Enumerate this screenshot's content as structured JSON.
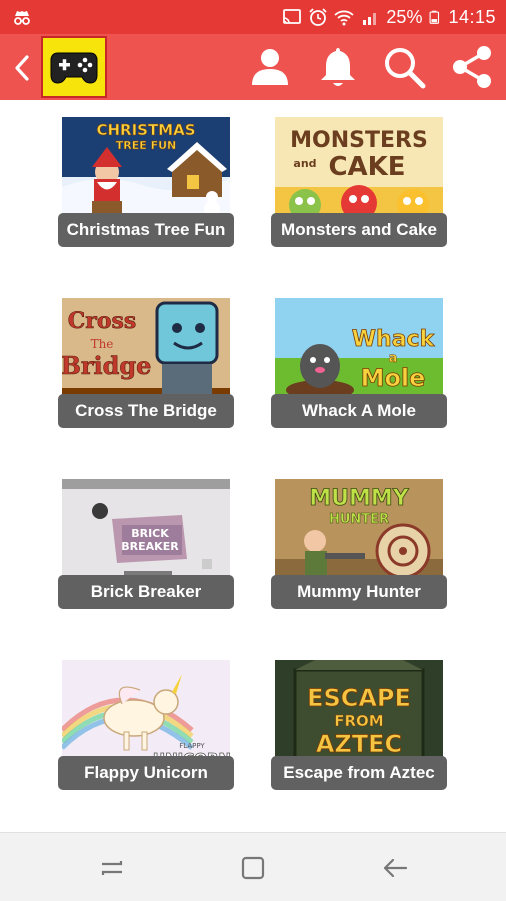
{
  "status_bar": {
    "battery_percent": "25%",
    "time": "14:15",
    "icons": [
      "incognito-icon",
      "cast-icon",
      "alarm-icon",
      "wifi-icon",
      "signal-icon",
      "battery-icon"
    ]
  },
  "app_bar": {
    "background": "#ef5350",
    "logo_background": "#f6e40b",
    "actions": [
      "profile-icon",
      "bell-icon",
      "search-icon",
      "share-icon"
    ]
  },
  "games": [
    {
      "title": "Christmas Tree Fun"
    },
    {
      "title": "Monsters and Cake"
    },
    {
      "title": "Cross The Bridge"
    },
    {
      "title": "Whack A Mole"
    },
    {
      "title": "Brick Breaker"
    },
    {
      "title": "Mummy Hunter"
    },
    {
      "title": "Flappy Unicorn"
    },
    {
      "title": "Escape from Aztec"
    }
  ],
  "thumb_text": {
    "christmas": [
      "CHRISTMAS",
      "TREE FUN"
    ],
    "monsters": [
      "MONSTERS",
      "and",
      "CAKE"
    ],
    "cross": [
      "Cross",
      "The",
      "Bridge"
    ],
    "whack": [
      "Whack",
      "a",
      "Mole"
    ],
    "brick": [
      "BRICK",
      "BREAKER"
    ],
    "mummy": [
      "MUMMY",
      "HUNTER"
    ],
    "unicorn": [
      "FLAPPY",
      "UNICORN"
    ],
    "aztec": [
      "ESCAPE",
      "FROM",
      "AZTEC"
    ]
  },
  "nav_bar": {
    "buttons": [
      "recents-icon",
      "home-icon",
      "back-icon"
    ]
  }
}
